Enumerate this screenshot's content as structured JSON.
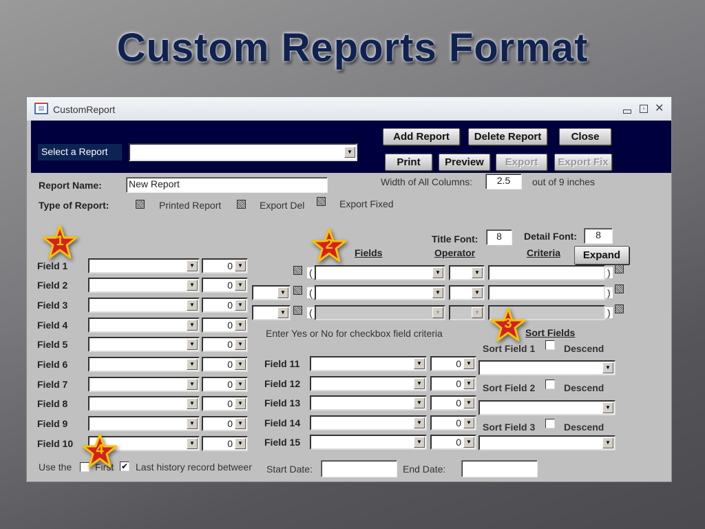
{
  "slide": {
    "title": "Custom Reports Format"
  },
  "window": {
    "title": "CustomReport",
    "controls": [
      "minimize",
      "restore",
      "close"
    ]
  },
  "header": {
    "select_label": "Select a Report",
    "select_value": "",
    "buttons": {
      "add": "Add Report",
      "delete": "Delete Report",
      "close": "Close",
      "print": "Print",
      "preview": "Preview",
      "export": "Export",
      "export_fix": "Export Fix"
    }
  },
  "report": {
    "name_label": "Report Name:",
    "name_value": "New Report",
    "type_label": "Type of Report:",
    "types": [
      "Printed Report",
      "Export Del",
      "Export Fixed"
    ],
    "width_label": "Width of All Columns:",
    "width_value": "2.5",
    "width_suffix": "out of 9 inches"
  },
  "criteria": {
    "title_font_label": "Title Font:",
    "title_font": "8",
    "detail_font_label": "Detail Font:",
    "detail_font": "8",
    "fields_header": "Fields",
    "operator_header": "Operator",
    "criteria_header": "Criteria",
    "expand": "Expand",
    "open_paren": "(",
    "close_paren": ")",
    "note": "Enter Yes or No for checkbox field criteria"
  },
  "fields_left": [
    {
      "label": "Field 1",
      "width": "0"
    },
    {
      "label": "Field 2",
      "width": "0"
    },
    {
      "label": "Field 3",
      "width": "0"
    },
    {
      "label": "Field 4",
      "width": "0"
    },
    {
      "label": "Field 5",
      "width": "0"
    },
    {
      "label": "Field 6",
      "width": "0"
    },
    {
      "label": "Field 7",
      "width": "0"
    },
    {
      "label": "Field 8",
      "width": "0"
    },
    {
      "label": "Field 9",
      "width": "0"
    },
    {
      "label": "Field 10",
      "width": "0"
    }
  ],
  "fields_right": [
    {
      "label": "Field 11",
      "width": "0"
    },
    {
      "label": "Field 12",
      "width": "0"
    },
    {
      "label": "Field 13",
      "width": "0"
    },
    {
      "label": "Field 14",
      "width": "0"
    },
    {
      "label": "Field 15",
      "width": "0"
    }
  ],
  "sort": {
    "header": "Sort Fields",
    "items": [
      {
        "label": "Sort Field 1",
        "descend": "Descend"
      },
      {
        "label": "Sort Field 2",
        "descend": "Descend"
      },
      {
        "label": "Sort Field 3",
        "descend": "Descend"
      }
    ]
  },
  "history": {
    "use_the": "Use the",
    "first": "First",
    "first_checked": false,
    "last": "Last history record betweer",
    "last_checked": true,
    "start_label": "Start Date:",
    "end_label": "End Date:",
    "start_value": "",
    "end_value": ""
  },
  "callouts": [
    "1",
    "2",
    "3",
    "4"
  ],
  "colors": {
    "header": "#00003f",
    "body": "#c0c0c0",
    "star": "#d42020",
    "star_border": "#f5c400",
    "title": "#10224f"
  }
}
